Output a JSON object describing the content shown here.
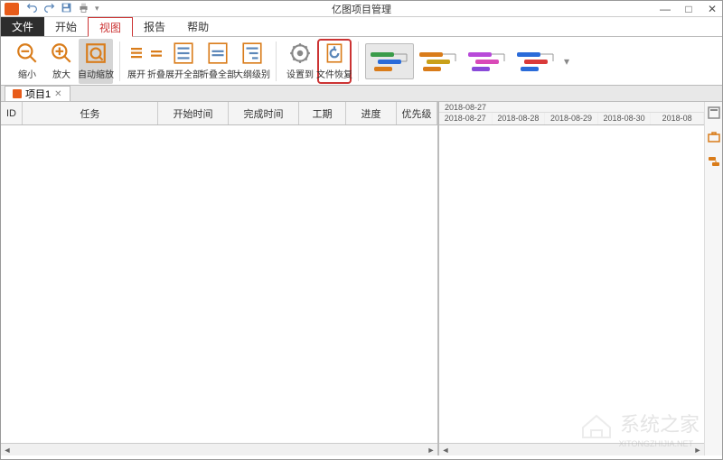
{
  "title": "亿图项目管理",
  "win": {
    "min": "—",
    "max": "□",
    "close": "✕"
  },
  "menu": {
    "file": "文件",
    "tabs": [
      "开始",
      "视图",
      "报告",
      "帮助"
    ],
    "active_index": 1
  },
  "ribbon": {
    "zoom_out": "缩小",
    "zoom_in": "放大",
    "auto_zoom": "自动缩放",
    "expand": "展开",
    "collapse": "折叠",
    "expand_all": "展开全部",
    "collapse_all": "折叠全部",
    "outline_level": "大纲级别",
    "settings_to": "设置到",
    "file_restore": "文件恢复"
  },
  "doc_tab": {
    "name": "项目1",
    "close": "✕"
  },
  "table": {
    "id": "ID",
    "task": "任务",
    "start": "开始时间",
    "end": "完成时间",
    "duration": "工期",
    "progress": "进度",
    "priority": "优先级"
  },
  "timeline": {
    "range_label": "2018-08-27",
    "dates": [
      "2018-08-27",
      "2018-08-28",
      "2018-08-29",
      "2018-08-30",
      "2018-08"
    ]
  },
  "watermark": {
    "text": "系统之家",
    "sub": "XITONGZHIJIA.NET"
  }
}
